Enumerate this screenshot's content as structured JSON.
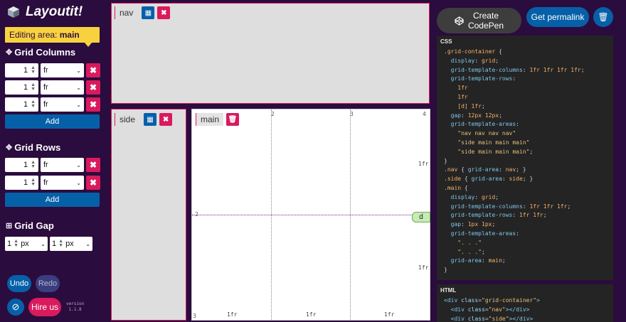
{
  "app": {
    "title": "Layoutit!"
  },
  "editing": {
    "prefix": "Editing area: ",
    "area": "main"
  },
  "columns": {
    "title": "Grid Columns",
    "rows": [
      {
        "value": "1",
        "unit": "fr"
      },
      {
        "value": "1",
        "unit": "fr"
      },
      {
        "value": "1",
        "unit": "fr"
      }
    ],
    "add_label": "Add"
  },
  "rows": {
    "title": "Grid Rows",
    "rows": [
      {
        "value": "1",
        "unit": "fr"
      },
      {
        "value": "1",
        "unit": "fr"
      }
    ],
    "add_label": "Add"
  },
  "gap": {
    "title": "Grid Gap",
    "col": {
      "value": "1",
      "unit": "px"
    },
    "row": {
      "value": "1",
      "unit": "px"
    }
  },
  "footer": {
    "undo": "Undo",
    "redo": "Redo",
    "hire": "Hire us",
    "version_line1": "version",
    "version_line2": "1.1.8"
  },
  "areas": {
    "nav": "nav",
    "side": "side",
    "main": "main"
  },
  "main_grid": {
    "col_ticks": [
      "2",
      "3",
      "4"
    ],
    "row_ticks": [
      "2",
      "3"
    ],
    "col_labels": [
      "1fr",
      "1fr",
      "1fr"
    ],
    "row_labels": [
      "1fr",
      "1fr"
    ],
    "area_pill": "d"
  },
  "toolbar": {
    "codepen": "Create CodePen",
    "codepen_line1": "Create",
    "codepen_line2": "CodePen",
    "permalink": "Get permalink"
  },
  "css_header": "CSS",
  "html_header": "HTML",
  "colors": {
    "pink": "#d91a5d",
    "blue": "#0660a8",
    "bg": "#2b0c3e",
    "yellow": "#f7d23e",
    "area": "#dedede"
  }
}
